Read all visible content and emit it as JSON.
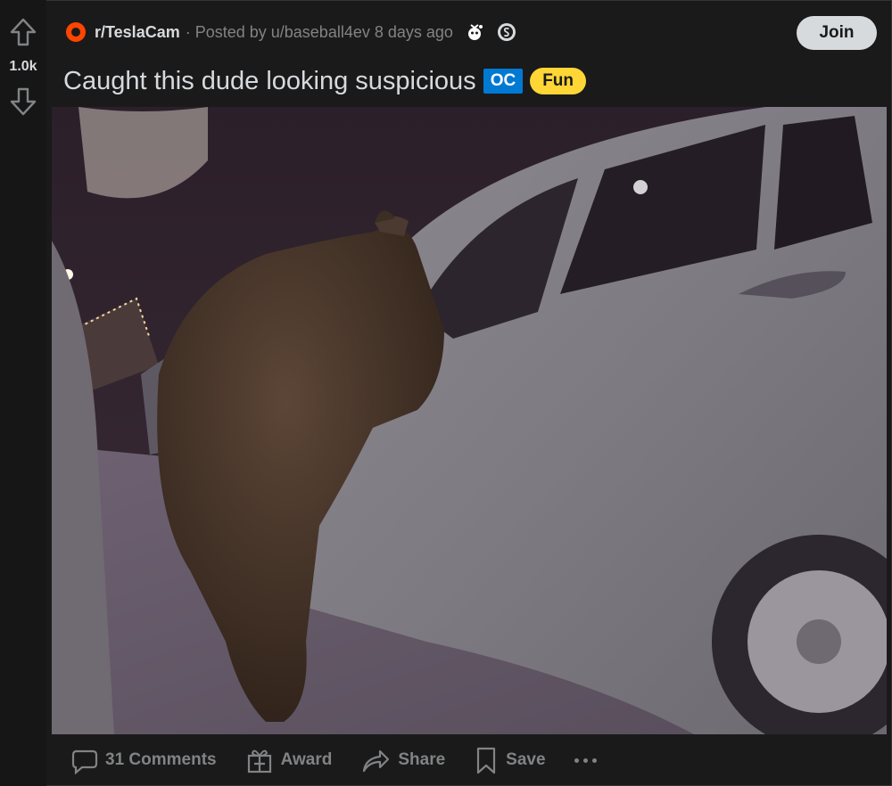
{
  "vote": {
    "score": "1.0k"
  },
  "post": {
    "subreddit": "r/TeslaCam",
    "posted_by": "· Posted by u/baseball4ev 8 days ago",
    "title": "Caught this dude looking suspicious",
    "oc_badge": "OC",
    "flair": "Fun",
    "join_label": "Join",
    "media_alt": "bear at car door dashcam photo"
  },
  "actions": {
    "comments": "31 Comments",
    "award": "Award",
    "share": "Share",
    "save": "Save"
  },
  "colors": {
    "background": "#1a1a1b",
    "accent": "#ff4500",
    "oc": "#0079d3",
    "flair": "#ffd635"
  }
}
